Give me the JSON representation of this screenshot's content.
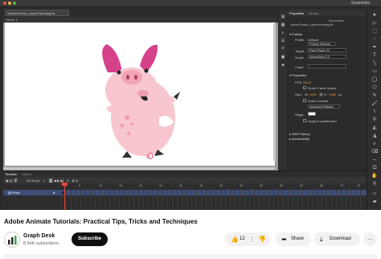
{
  "video": {
    "workspace_label": "Essentials",
    "document_tab": "SweetCheeks_LayerParenting.fla",
    "scene_label": "Scene 1",
    "properties_panel": {
      "tabs": [
        "Properties",
        "Library"
      ],
      "doc_label": "Document",
      "doc_name": "SweetCheeks_LayerParenting.fla",
      "publish_section": "Publish",
      "profile_label": "Profile:",
      "profile_value": "Default",
      "publish_settings": "Publish Settings...",
      "target_label": "Target:",
      "target_value": "Flash Player 30",
      "script_label": "Script:",
      "script_value": "ActionScript 3.0",
      "class_label": "Class:",
      "properties_section": "Properties",
      "fps_label": "FPS:",
      "fps_value": "24.00",
      "scale_frame_spans": "Scale Frame Spans",
      "size_label": "Size:",
      "w_label": "W:",
      "width_value": "1920",
      "h_label": "H:",
      "height_value": "1080",
      "px_label": "px",
      "scale_content": "Scale Content",
      "advanced_settings": "Advanced Settings",
      "stage_label": "Stage:",
      "apply_pasteboard": "Apply to pasteboard",
      "swf_history": "SWF History",
      "accessibility": "Accessibility"
    },
    "timeline": {
      "tabs": [
        "Timeline",
        "Output"
      ],
      "fps_readout": "24.00 fps",
      "frame_readout": "1",
      "layer_name": "Pinky",
      "ruler_ticks": [
        "5",
        "10",
        "15",
        "20",
        "25",
        "30",
        "35",
        "40",
        "45",
        "50",
        "55",
        "60",
        "65",
        "70",
        "75"
      ]
    },
    "colors": {
      "pig_body": "#f7c6cf",
      "pig_dark": "#e58aa0",
      "ear_magenta": "#d6418c",
      "layer_highlight": "#3d4d77",
      "playhead": "#e5483a"
    }
  },
  "page": {
    "video_title": "Adobe Animate Tutorials: Practical Tips, Tricks and Techniques",
    "channel_name": "Graph Desk",
    "subscriber_count": "8.54K subscribers",
    "subscribe_label": "Subscribe",
    "like_count": "12",
    "share_label": "Share",
    "download_label": "Download",
    "more_label": "..."
  },
  "icons": [
    "thumbs-up-icon",
    "thumbs-down-icon",
    "share-arrow-icon",
    "download-icon",
    "more-icon",
    "channel-logo-icon"
  ]
}
